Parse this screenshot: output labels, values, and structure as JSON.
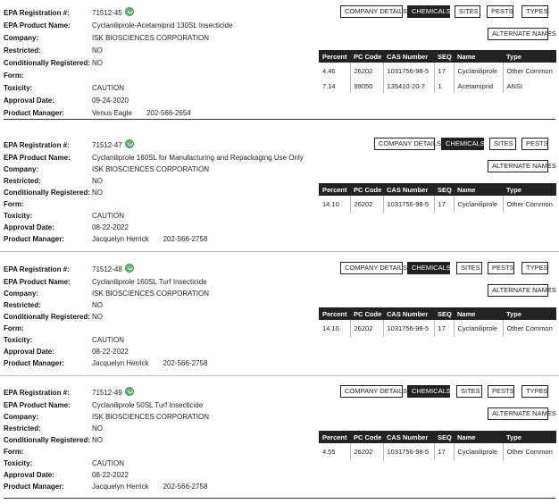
{
  "labels": {
    "reg": "EPA Registration #:",
    "product": "EPA Product Name:",
    "company": "Company:",
    "restricted": "Restricted:",
    "conditional": "Conditionally Registered:",
    "form": "Form:",
    "toxicity": "Toxicity:",
    "approval": "Approval Date:",
    "manager": "Product Manager:"
  },
  "buttons": {
    "company_details": "COMPANY DETAILS",
    "chemicals": "CHEMICALS",
    "sites": "SITES",
    "pests": "PESTS",
    "types": "TYPES",
    "alternate_names": "ALTERNATE NAMES"
  },
  "table_headers": [
    "Percent",
    "PC Code",
    "CAS Number",
    "SEQ",
    "Name",
    "Type"
  ],
  "records": [
    {
      "reg_no": "71512-45",
      "product_name": "Cyclaniliprole-Acetamiprid 130SL Insecticide",
      "company": "ISK BIOSCIENCES CORPORATION",
      "restricted": "NO",
      "conditional": "NO",
      "form": "",
      "toxicity": "CAUTION",
      "approval_date": "09-24-2020",
      "manager_name": "Venus Eagle",
      "manager_phone": "202-566-2654",
      "chemicals": [
        {
          "percent": "4.46",
          "pc_code": "26202",
          "cas": "1031756-98-5",
          "seq": "17",
          "name": "Cyclaniliprole",
          "type": "Other Common"
        },
        {
          "percent": "7.14",
          "pc_code": "99050",
          "cas": "135410-20-7",
          "seq": "1",
          "name": "Acetamiprid",
          "type": "ANSI"
        }
      ]
    },
    {
      "reg_no": "71512-47",
      "product_name": "Cyclaniliprole 160SL for Manufacturing and Repackaging Use Only",
      "company": "ISK BIOSCIENCES CORPORATION",
      "restricted": "NO",
      "conditional": "NO",
      "form": "",
      "toxicity": "CAUTION",
      "approval_date": "08-22-2022",
      "manager_name": "Jacquelyn Herrick",
      "manager_phone": "202-566-2758",
      "chemicals": [
        {
          "percent": "14.10",
          "pc_code": "26202",
          "cas": "1031756-98-5",
          "seq": "17",
          "name": "Cyclaniliprole",
          "type": "Other Common"
        }
      ]
    },
    {
      "reg_no": "71512-48",
      "product_name": "Cyclaniliprole 160SL Turf Insecticide",
      "company": "ISK BIOSCIENCES CORPORATION",
      "restricted": "NO",
      "conditional": "NO",
      "form": "",
      "toxicity": "CAUTION",
      "approval_date": "08-22-2022",
      "manager_name": "Jacquelyn Herrick",
      "manager_phone": "202-566-2758",
      "chemicals": [
        {
          "percent": "14.10",
          "pc_code": "26202",
          "cas": "1031756-98-5",
          "seq": "17",
          "name": "Cyclaniliprole",
          "type": "Other Common"
        }
      ]
    },
    {
      "reg_no": "71512-49",
      "product_name": "Cyclaniliprole 50SL Turf Insecticide",
      "company": "ISK BIOSCIENCES CORPORATION",
      "restricted": "NO",
      "conditional": "NO",
      "form": "",
      "toxicity": "CAUTION",
      "approval_date": "08-22-2022",
      "manager_name": "Jacquelyn Herrick",
      "manager_phone": "202-566-2758",
      "chemicals": [
        {
          "percent": "4.55",
          "pc_code": "26202",
          "cas": "1031756-98-5",
          "seq": "17",
          "name": "Cyclaniliprole",
          "type": "Other Common"
        }
      ]
    }
  ]
}
